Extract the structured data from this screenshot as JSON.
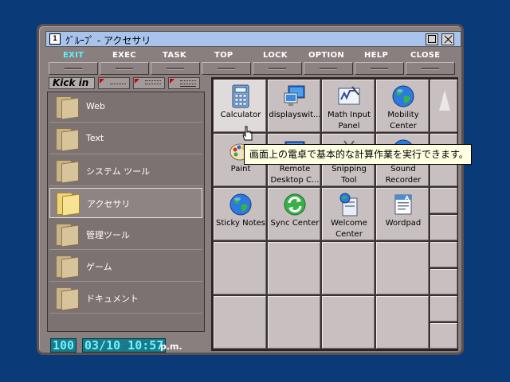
{
  "window": {
    "title": "ｸﾞﾙｰﾌﾟ - アクセサリ",
    "icon_text": "1"
  },
  "menu": [
    "EXIT",
    "EXEC",
    "TASK",
    "TOP",
    "LOCK",
    "OPTION",
    "HELP",
    "CLOSE"
  ],
  "kick": {
    "label": "Kick in"
  },
  "groups": [
    {
      "label": "Web"
    },
    {
      "label": "Text"
    },
    {
      "label": "システム ツール"
    },
    {
      "label": "アクセサリ",
      "active": true
    },
    {
      "label": "管理ツール"
    },
    {
      "label": "ゲーム"
    },
    {
      "label": "ドキュメント"
    }
  ],
  "apps": [
    {
      "label": "Calculator",
      "label2": "",
      "icon": "calculator-icon"
    },
    {
      "label": "displayswit...",
      "label2": "",
      "icon": "display-switch-icon"
    },
    {
      "label": "Math Input",
      "label2": "Panel",
      "icon": "math-input-icon"
    },
    {
      "label": "Mobility",
      "label2": "Center",
      "icon": "globe-icon"
    },
    {
      "label": "Paint",
      "label2": "",
      "icon": "paint-icon"
    },
    {
      "label": "Remote",
      "label2": "Desktop C...",
      "icon": "remote-desktop-icon"
    },
    {
      "label": "Snipping",
      "label2": "Tool",
      "icon": "snipping-tool-icon"
    },
    {
      "label": "Sound",
      "label2": "Recorder",
      "icon": "globe-icon"
    },
    {
      "label": "Sticky Notes",
      "label2": "",
      "icon": "globe-icon"
    },
    {
      "label": "Sync Center",
      "label2": "",
      "icon": "sync-icon"
    },
    {
      "label": "Welcome",
      "label2": "Center",
      "icon": "welcome-center-icon"
    },
    {
      "label": "Wordpad",
      "label2": "",
      "icon": "wordpad-icon"
    }
  ],
  "tooltip": "画面上の電卓で基本的な計算作業を実行できます。",
  "status": {
    "number": "100",
    "datetime": "03/10 10:57",
    "ampm": "p.m."
  },
  "colors": {
    "background": "#0b3a78",
    "titlebar": "#a8c4ec",
    "lcd_text": "#6ff4ff",
    "active_menu": "#5ff0ff"
  }
}
